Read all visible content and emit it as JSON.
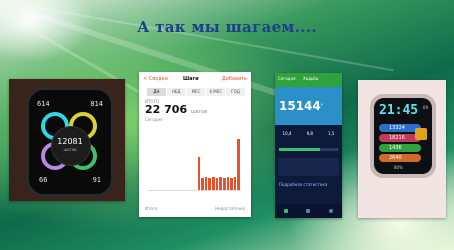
{
  "slide": {
    "title": "А так мы шагаем...."
  },
  "watch1": {
    "steps": "12081",
    "steps_unit": "шагов",
    "corner_tl": "614",
    "corner_tr": "814",
    "corner_bl": "66",
    "corner_br": "91"
  },
  "phone2": {
    "back": "< Сводка",
    "header": "Шаги",
    "add": "Добавить",
    "tabs": [
      "ДН",
      "НЕД",
      "МЕС",
      "6 МЕС",
      "ГОД"
    ],
    "label_total": "ИТОГО",
    "steps": "22 706",
    "steps_unit": "шагов",
    "day_label": "Сегодня",
    "bars": [
      0,
      0,
      0,
      0,
      0,
      0,
      0,
      0,
      0,
      0,
      0,
      0,
      0,
      0,
      55,
      20,
      22,
      20,
      22,
      20,
      22,
      20,
      22,
      20,
      22,
      85
    ],
    "x_left": "Итого",
    "x_right": "Недостаточно"
  },
  "phone3": {
    "header_left": "Сегодня",
    "header_tab": "Ходьба",
    "steps": "15144",
    "steps_mark": "ʹ",
    "stats": [
      "10,4",
      "9,8",
      "1,5"
    ],
    "footer": "Подробная статистика"
  },
  "watch4": {
    "time": "21:45",
    "ampm": "09",
    "rows": [
      "13324",
      "18216",
      "1436",
      "2640"
    ],
    "battery": "80%"
  },
  "colors": {
    "title": "#1e3f8a",
    "bar": "#e8512c",
    "accent_green": "#2fa23b"
  }
}
